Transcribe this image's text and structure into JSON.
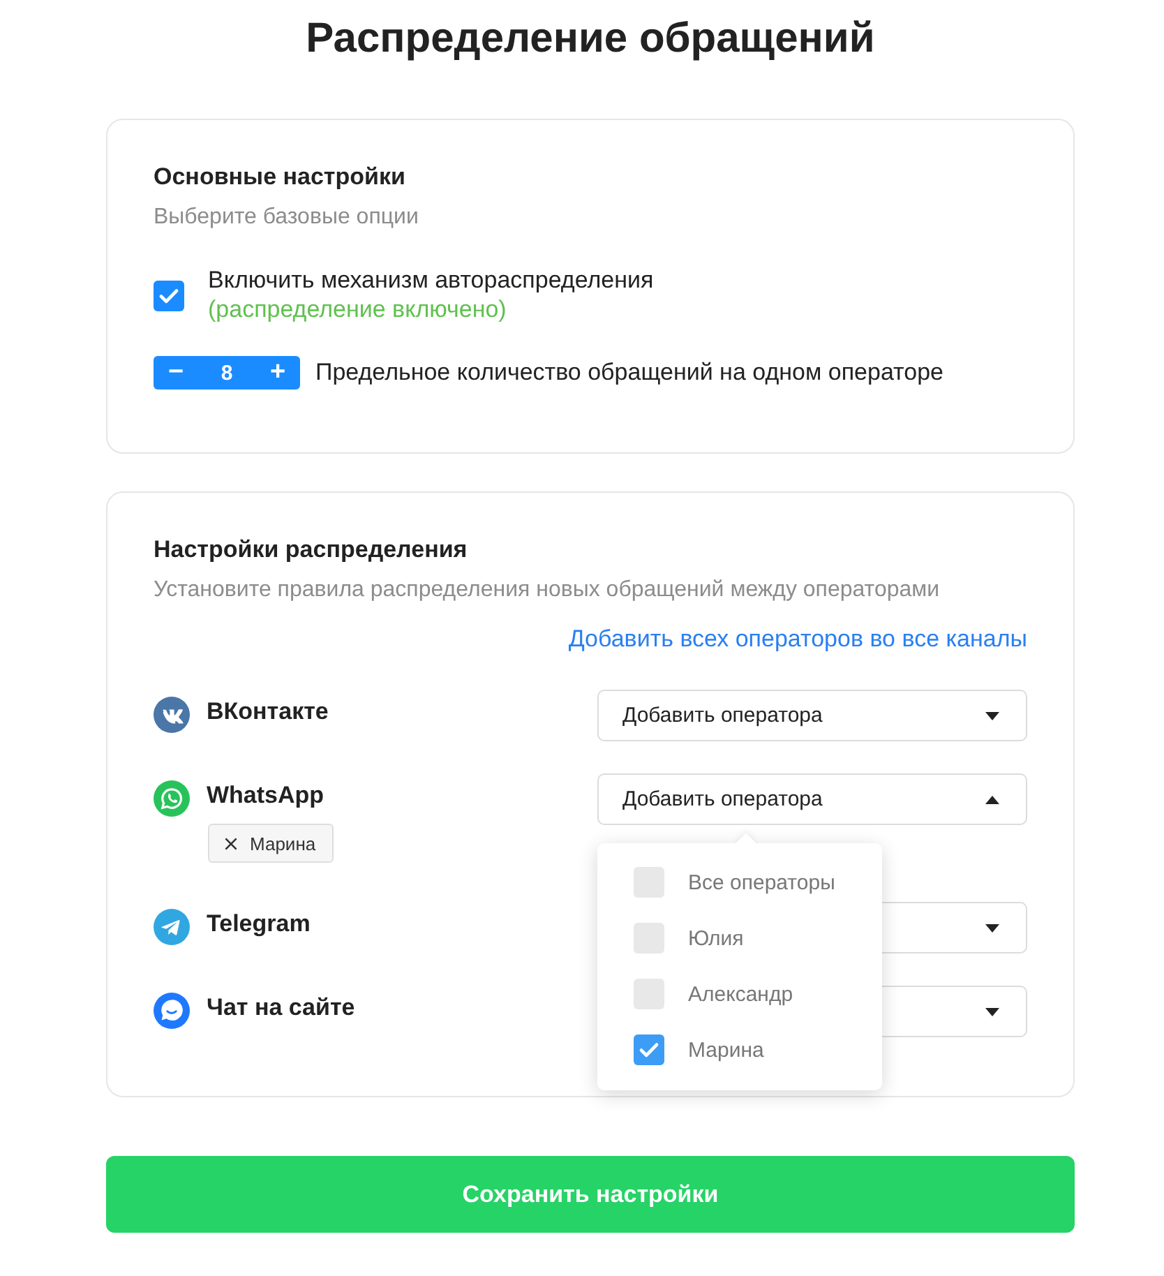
{
  "page": {
    "title": "Распределение обращений"
  },
  "basic_settings": {
    "title": "Основные настройки",
    "subtitle": "Выберите базовые опции",
    "auto_distribution": {
      "label": "Включить механизм автораспределения",
      "status": "(распределение включено)",
      "checked": true
    },
    "limit": {
      "decrement": "−",
      "value": "8",
      "increment": "+",
      "label": "Предельное количество обращений на одном операторе"
    }
  },
  "distribution_settings": {
    "title": "Настройки распределения",
    "subtitle": "Установите правила распределения новых обращений между операторами",
    "add_all_link": "Добавить всех операторов во все каналы",
    "channels": [
      {
        "kind": "vk",
        "name": "ВКонтакте",
        "dropdown": {
          "label": "Добавить оператора",
          "expanded": false
        }
      },
      {
        "kind": "whatsapp",
        "name": "WhatsApp",
        "tags": [
          "Марина"
        ],
        "dropdown": {
          "label": "Добавить оператора",
          "expanded": true,
          "options": [
            {
              "label": "Все операторы",
              "checked": false
            },
            {
              "label": "Юлия",
              "checked": false
            },
            {
              "label": "Александр",
              "checked": false
            },
            {
              "label": "Марина",
              "checked": true
            }
          ]
        }
      },
      {
        "kind": "telegram",
        "name": "Telegram",
        "dropdown": {
          "expanded": false
        }
      },
      {
        "kind": "site_chat",
        "name": "Чат на сайте",
        "dropdown": {
          "expanded": false
        }
      }
    ]
  },
  "save_button": "Сохранить настройки"
}
